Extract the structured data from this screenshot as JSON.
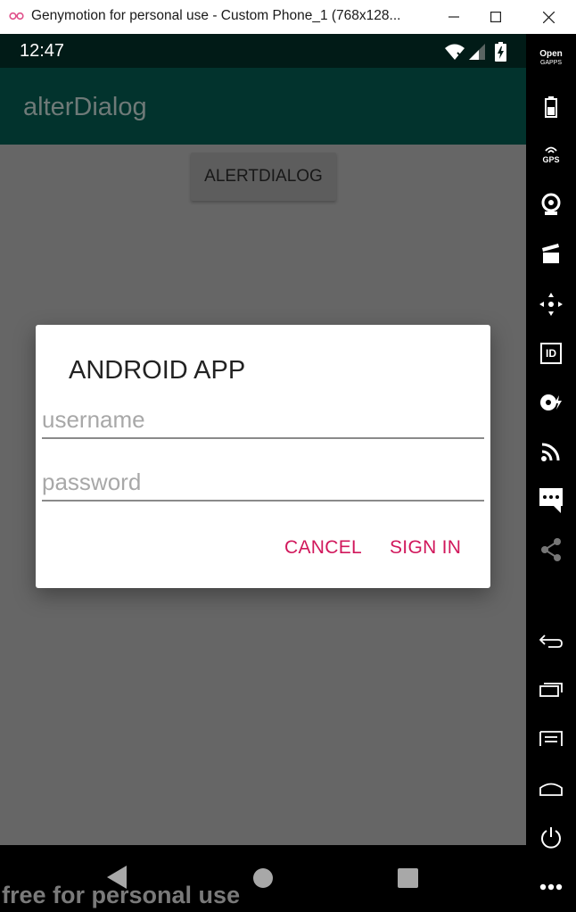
{
  "window": {
    "title": "Genymotion for personal use - Custom Phone_1 (768x128...",
    "controls": [
      "minimize",
      "maximize",
      "close"
    ]
  },
  "status_bar": {
    "time": "12:47"
  },
  "app_bar": {
    "title": "alterDialog"
  },
  "main": {
    "alert_button_label": "ALERTDIALOG"
  },
  "dialog": {
    "title": "ANDROID APP",
    "username_placeholder": "username",
    "password_placeholder": "password",
    "username_value": "",
    "password_value": "",
    "cancel_label": "CANCEL",
    "signin_label": "SIGN IN"
  },
  "watermark": "free for personal use",
  "sidebar": {
    "open_gapps_label_1": "Open",
    "open_gapps_label_2": "GAPPS",
    "gps_label": "GPS",
    "id_label": "ID",
    "icons": [
      "open-gapps-icon",
      "battery-icon",
      "gps-icon",
      "camera-icon",
      "media-icon",
      "navigation-icon",
      "device-id-icon",
      "sound-icon",
      "cast-icon",
      "sms-icon",
      "share-icon",
      "back-icon",
      "recents-icon",
      "menu-icon",
      "home-icon",
      "power-icon",
      "more-icon"
    ]
  },
  "colors": {
    "status_bar": "#011b17",
    "app_bar": "#02332d",
    "dialog_button": "#d1185c",
    "scrim": "#666666"
  }
}
